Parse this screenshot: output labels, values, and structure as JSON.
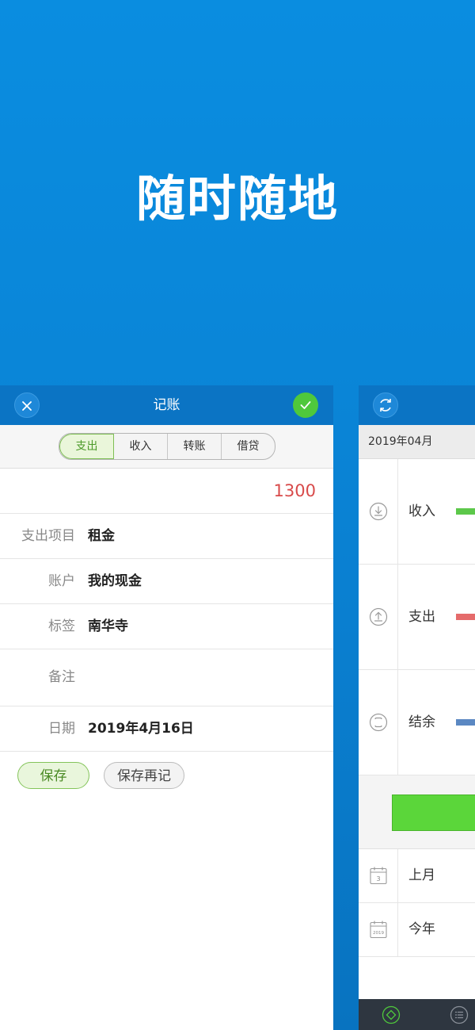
{
  "headline": "随时随地",
  "entry": {
    "title": "记账",
    "close_icon": "close-icon",
    "confirm_icon": "check-icon",
    "tabs": [
      "支出",
      "收入",
      "转账",
      "借贷"
    ],
    "active_tab": "支出",
    "amount": "1300",
    "fields": {
      "category": {
        "label": "支出项目",
        "value": "租金"
      },
      "account": {
        "label": "账户",
        "value": "我的现金"
      },
      "tag": {
        "label": "标签",
        "value": "南华寺"
      },
      "note": {
        "label": "备注",
        "value": ""
      },
      "date": {
        "label": "日期",
        "value": "2019年4月16日"
      }
    },
    "save_label": "保存",
    "save_again_label": "保存再记"
  },
  "report": {
    "refresh_icon": "refresh-icon",
    "month": "2019年04月",
    "stats": [
      {
        "label": "收入",
        "icon": "download-icon",
        "color": "#5cc84a"
      },
      {
        "label": "支出",
        "icon": "upload-icon",
        "color": "#e56b6b"
      },
      {
        "label": "结余",
        "icon": "balance-icon",
        "color": "#5b88c2"
      }
    ],
    "periods": [
      {
        "label": "上月",
        "icon": "calendar-icon",
        "icon_text": "3"
      },
      {
        "label": "今年",
        "icon": "calendar-icon",
        "icon_text": "2019"
      }
    ],
    "tab_icons": [
      "home-icon",
      "list-icon"
    ]
  },
  "colors": {
    "background": "#0a86d8",
    "nav": "#0b74c4",
    "confirm": "#4fc83c",
    "amount": "#d84a4a",
    "save_green": "#4a8a24"
  }
}
